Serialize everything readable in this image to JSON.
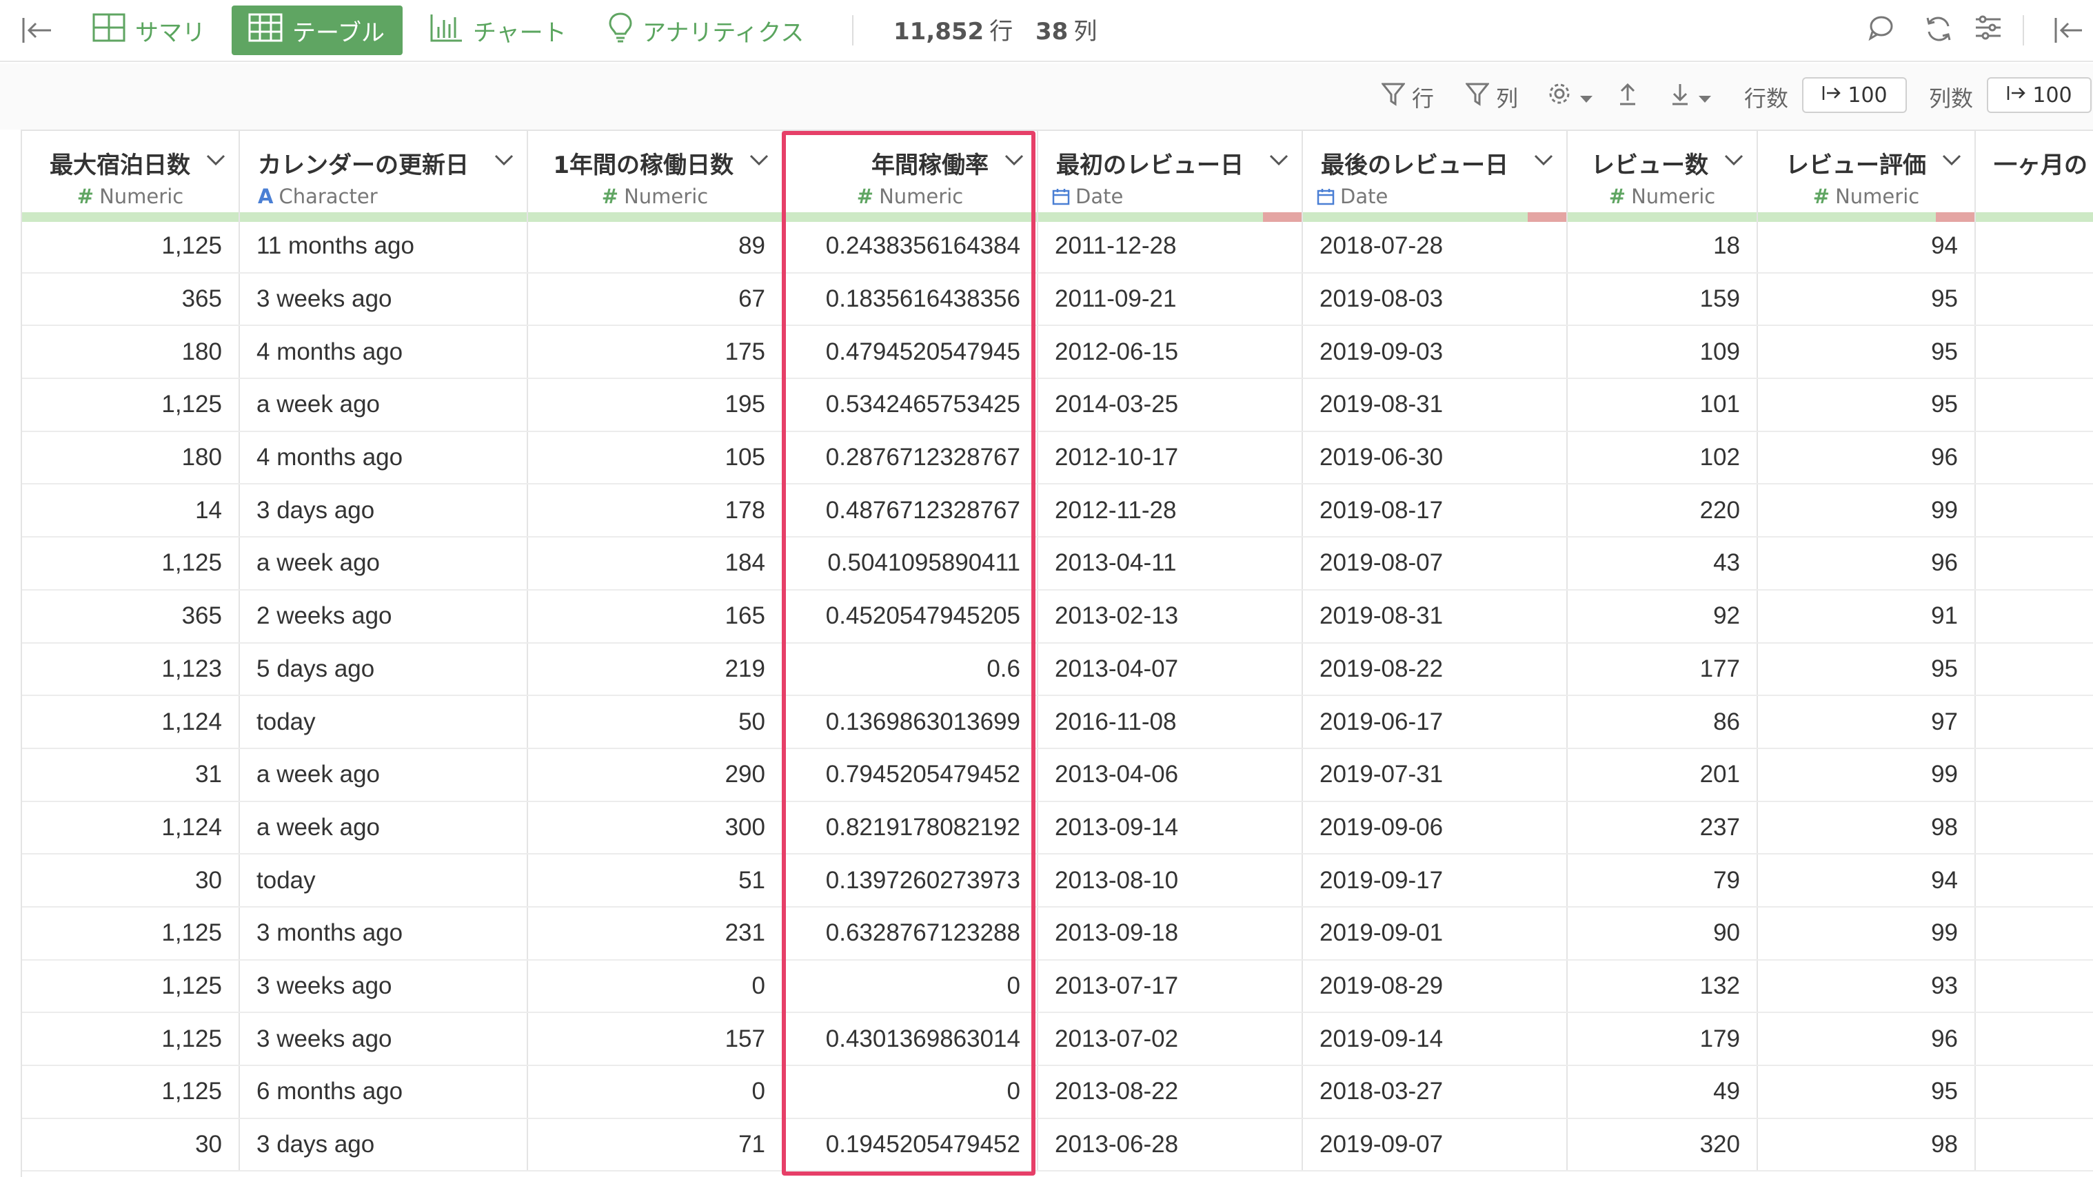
{
  "toolbar": {
    "tabs": [
      {
        "label": "サマリ",
        "icon": "grid-icon",
        "active": false
      },
      {
        "label": "テーブル",
        "icon": "table-icon",
        "active": true
      },
      {
        "label": "チャート",
        "icon": "bar-chart-icon",
        "active": false
      },
      {
        "label": "アナリティクス",
        "icon": "lightbulb-icon",
        "active": false
      }
    ],
    "row_count": "11,852",
    "row_unit": "行",
    "col_count": "38",
    "col_unit": "列",
    "accent_color": "#5fa562"
  },
  "subbar": {
    "filter_row_label": "行",
    "filter_col_label": "列",
    "rows_label": "行数",
    "rows_value": "100",
    "cols_label": "列数",
    "cols_value": "100"
  },
  "columns": [
    {
      "title": "最大宿泊日数",
      "type": "Numeric",
      "kind": "num",
      "align": "r"
    },
    {
      "title": "カレンダーの更新日",
      "type": "Character",
      "kind": "chr",
      "align": "l"
    },
    {
      "title": "1年間の稼働日数",
      "type": "Numeric",
      "kind": "num",
      "align": "r"
    },
    {
      "title": "年間稼働率",
      "type": "Numeric",
      "kind": "num",
      "align": "r"
    },
    {
      "title": "最初のレビュー日",
      "type": "Date",
      "kind": "date",
      "align": "l"
    },
    {
      "title": "最後のレビュー日",
      "type": "Date",
      "kind": "date",
      "align": "l"
    },
    {
      "title": "レビュー数",
      "type": "Numeric",
      "kind": "num",
      "align": "r"
    },
    {
      "title": "レビュー評価",
      "type": "Numeric",
      "kind": "num",
      "align": "r"
    },
    {
      "title": "一ヶ月の",
      "type": "",
      "kind": "none",
      "align": "r"
    }
  ],
  "rows": [
    [
      "1,125",
      "11 months ago",
      "89",
      "0.2438356164384",
      "2011-12-28",
      "2018-07-28",
      "18",
      "94",
      ""
    ],
    [
      "365",
      "3 weeks ago",
      "67",
      "0.1835616438356",
      "2011-09-21",
      "2019-08-03",
      "159",
      "95",
      ""
    ],
    [
      "180",
      "4 months ago",
      "175",
      "0.4794520547945",
      "2012-06-15",
      "2019-09-03",
      "109",
      "95",
      ""
    ],
    [
      "1,125",
      "a week ago",
      "195",
      "0.5342465753425",
      "2014-03-25",
      "2019-08-31",
      "101",
      "95",
      ""
    ],
    [
      "180",
      "4 months ago",
      "105",
      "0.2876712328767",
      "2012-10-17",
      "2019-06-30",
      "102",
      "96",
      ""
    ],
    [
      "14",
      "3 days ago",
      "178",
      "0.4876712328767",
      "2012-11-28",
      "2019-08-17",
      "220",
      "99",
      ""
    ],
    [
      "1,125",
      "a week ago",
      "184",
      "0.5041095890411",
      "2013-04-11",
      "2019-08-07",
      "43",
      "96",
      ""
    ],
    [
      "365",
      "2 weeks ago",
      "165",
      "0.4520547945205",
      "2013-02-13",
      "2019-08-31",
      "92",
      "91",
      ""
    ],
    [
      "1,123",
      "5 days ago",
      "219",
      "0.6",
      "2013-04-07",
      "2019-08-22",
      "177",
      "95",
      ""
    ],
    [
      "1,124",
      "today",
      "50",
      "0.1369863013699",
      "2016-11-08",
      "2019-06-17",
      "86",
      "97",
      ""
    ],
    [
      "31",
      "a week ago",
      "290",
      "0.7945205479452",
      "2013-04-06",
      "2019-07-31",
      "201",
      "99",
      ""
    ],
    [
      "1,124",
      "a week ago",
      "300",
      "0.8219178082192",
      "2013-09-14",
      "2019-09-06",
      "237",
      "98",
      ""
    ],
    [
      "30",
      "today",
      "51",
      "0.1397260273973",
      "2013-08-10",
      "2019-09-17",
      "79",
      "94",
      ""
    ],
    [
      "1,125",
      "3 months ago",
      "231",
      "0.6328767123288",
      "2013-09-18",
      "2019-09-01",
      "90",
      "99",
      ""
    ],
    [
      "1,125",
      "3 weeks ago",
      "0",
      "0",
      "2013-07-17",
      "2019-08-29",
      "132",
      "93",
      ""
    ],
    [
      "1,125",
      "3 weeks ago",
      "157",
      "0.4301369863014",
      "2013-07-02",
      "2019-09-14",
      "179",
      "96",
      ""
    ],
    [
      "1,125",
      "6 months ago",
      "0",
      "0",
      "2013-08-22",
      "2018-03-27",
      "49",
      "95",
      ""
    ],
    [
      "30",
      "3 days ago",
      "71",
      "0.1945205479452",
      "2013-06-28",
      "2019-09-07",
      "320",
      "98",
      ""
    ]
  ]
}
